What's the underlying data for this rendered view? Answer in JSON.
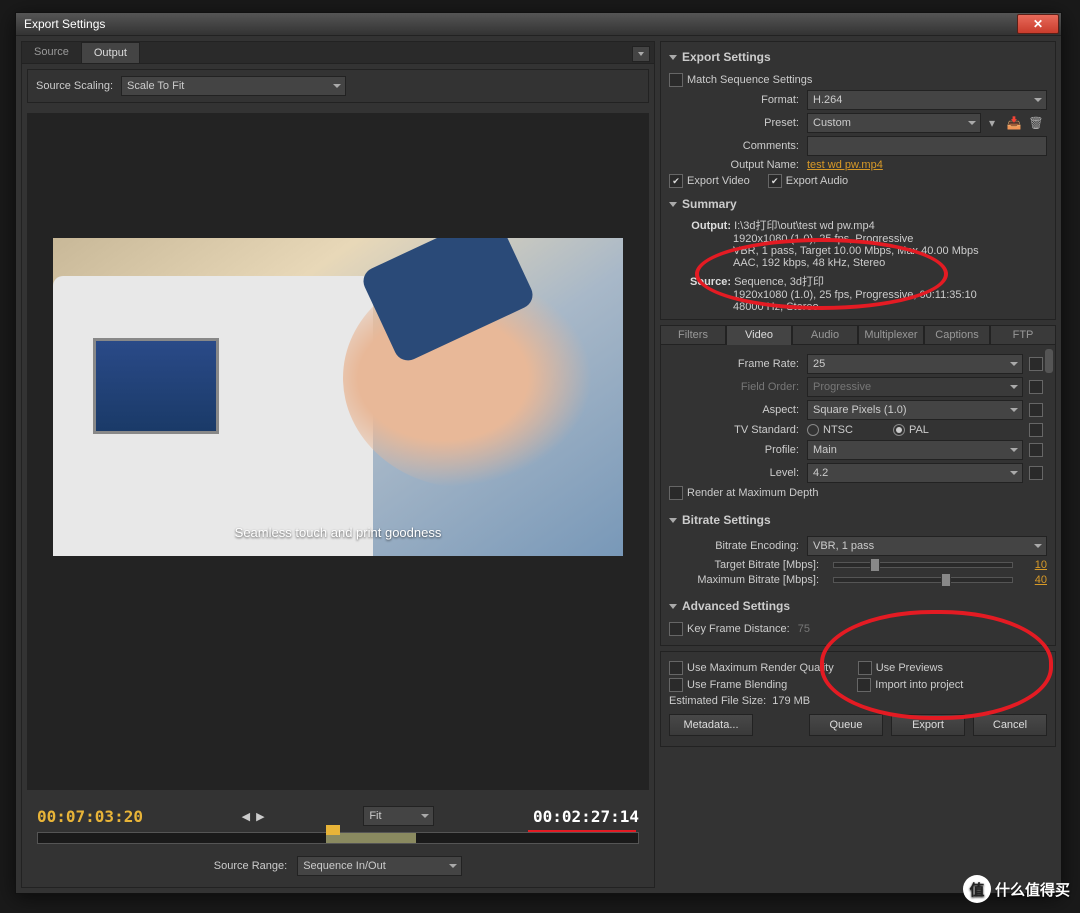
{
  "window": {
    "title": "Export Settings"
  },
  "leftPanel": {
    "tabs": {
      "source": "Source",
      "output": "Output"
    },
    "sourceScalingLabel": "Source Scaling:",
    "sourceScalingValue": "Scale To Fit",
    "subtitleText": "Seamless touch and print goodness",
    "currentTime": "00:07:03:20",
    "totalTime": "00:02:27:14",
    "fitLabel": "Fit",
    "sourceRangeLabel": "Source Range:",
    "sourceRangeValue": "Sequence In/Out"
  },
  "exportSettings": {
    "title": "Export Settings",
    "matchSequence": "Match Sequence Settings",
    "formatLabel": "Format:",
    "formatValue": "H.264",
    "presetLabel": "Preset:",
    "presetValue": "Custom",
    "commentsLabel": "Comments:",
    "outputNameLabel": "Output Name:",
    "outputNameValue": "test wd pw.mp4",
    "exportVideo": "Export Video",
    "exportAudio": "Export Audio"
  },
  "summary": {
    "title": "Summary",
    "outputLabel": "Output:",
    "outputPath": "I:\\3d打印\\out\\test wd pw.mp4",
    "outputLine2": "1920x1080 (1.0), 25 fps, Progressive",
    "outputLine3": "VBR, 1 pass, Target 10.00 Mbps, Max 40.00 Mbps",
    "outputLine4": "AAC, 192 kbps, 48 kHz, Stereo",
    "sourceLabel": "Source:",
    "sourceLine1": "Sequence, 3d打印",
    "sourceLine2": "1920x1080 (1.0), 25 fps, Progressive, 00:11:35:10",
    "sourceLine3": "48000 Hz, Stereo"
  },
  "videoTabs": {
    "filters": "Filters",
    "video": "Video",
    "audio": "Audio",
    "multiplexer": "Multiplexer",
    "captions": "Captions",
    "ftp": "FTP"
  },
  "videoSettings": {
    "frameRateLabel": "Frame Rate:",
    "frameRateValue": "25",
    "fieldOrderLabel": "Field Order:",
    "fieldOrderValue": "Progressive",
    "aspectLabel": "Aspect:",
    "aspectValue": "Square Pixels (1.0)",
    "tvStandardLabel": "TV Standard:",
    "ntsc": "NTSC",
    "pal": "PAL",
    "profileLabel": "Profile:",
    "profileValue": "Main",
    "levelLabel": "Level:",
    "levelValue": "4.2",
    "renderMaxDepth": "Render at Maximum Depth"
  },
  "bitrate": {
    "title": "Bitrate Settings",
    "encodingLabel": "Bitrate Encoding:",
    "encodingValue": "VBR, 1 pass",
    "targetLabel": "Target Bitrate [Mbps]:",
    "targetValue": "10",
    "maxLabel": "Maximum Bitrate [Mbps]:",
    "maxValue": "40"
  },
  "advanced": {
    "title": "Advanced Settings",
    "keyFrameLabel": "Key Frame Distance:",
    "keyFrameValue": "75"
  },
  "bottomOptions": {
    "maxRender": "Use Maximum Render Quality",
    "previews": "Use Previews",
    "frameBlending": "Use Frame Blending",
    "importProject": "Import into project",
    "estSizeLabel": "Estimated File Size:",
    "estSizeValue": "179 MB"
  },
  "buttons": {
    "metadata": "Metadata...",
    "queue": "Queue",
    "export": "Export",
    "cancel": "Cancel"
  },
  "watermark": "什么值得买"
}
